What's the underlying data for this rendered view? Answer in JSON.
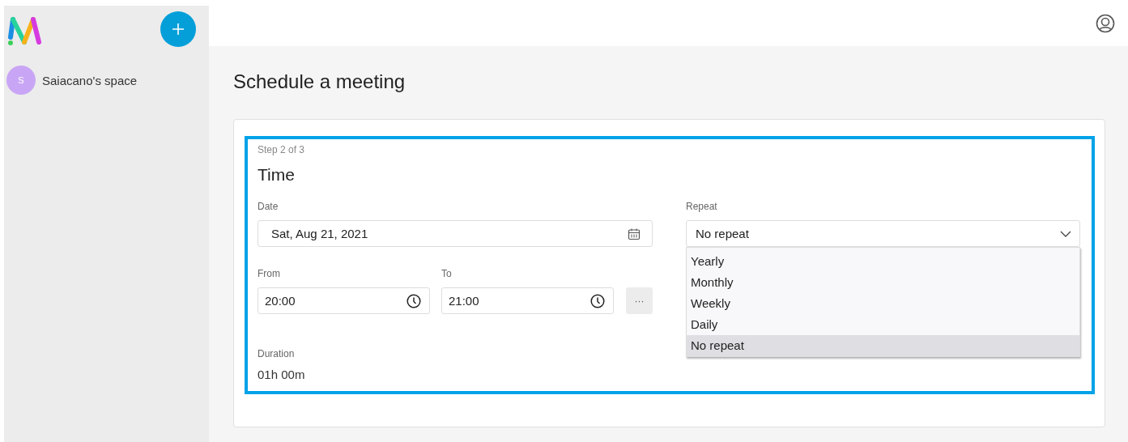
{
  "sidebar": {
    "spaces": [
      {
        "initial": "S",
        "name": "Saiacano's space",
        "selected": false
      }
    ]
  },
  "page": {
    "title": "Schedule a meeting"
  },
  "step": {
    "counter": "Step 2 of 3",
    "title": "Time",
    "date": {
      "label": "Date",
      "value": "Sat, Aug 21, 2021"
    },
    "from": {
      "label": "From",
      "value": "20:00"
    },
    "to": {
      "label": "To",
      "value": "21:00"
    },
    "more_button": "···",
    "duration": {
      "label": "Duration",
      "value": "01h 00m"
    },
    "repeat": {
      "label": "Repeat",
      "value": "No repeat",
      "expanded": true,
      "options": [
        {
          "label": "Yearly",
          "selected": false
        },
        {
          "label": "Monthly",
          "selected": false
        },
        {
          "label": "Weekly",
          "selected": false
        },
        {
          "label": "Daily",
          "selected": false
        },
        {
          "label": "No repeat",
          "selected": true
        }
      ]
    }
  }
}
